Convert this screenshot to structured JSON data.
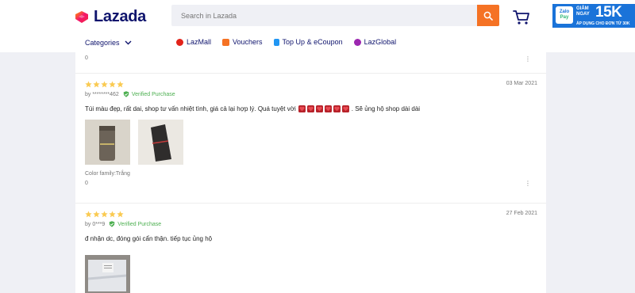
{
  "header": {
    "logo_text": "Lazada",
    "search_placeholder": "Search in Lazada",
    "icons": {
      "search": "search-icon",
      "cart": "cart-icon"
    },
    "promo": {
      "pay_top": "Zalo",
      "pay_bottom": "Pay",
      "label": "GIẢM NGAY",
      "amount": "15K",
      "sub": "ÁP DỤNG CHO ĐƠN TỪ 30K"
    }
  },
  "nav": {
    "categories_label": "Categories",
    "links": [
      {
        "label": "LazMall",
        "icon": "lazmall-icon",
        "color": "#e2231a"
      },
      {
        "label": "Vouchers",
        "icon": "voucher-icon",
        "color": "#f57224"
      },
      {
        "label": "Top Up & eCoupon",
        "icon": "topup-icon",
        "color": "#2196f3"
      },
      {
        "label": "LazGlobal",
        "icon": "lazglobal-icon",
        "color": "#9c27b0"
      }
    ]
  },
  "reviews": {
    "previous_likes": "0",
    "items": [
      {
        "rating": 5,
        "author": "by ********462",
        "verified": "Verified Purchase",
        "date": "03 Mar 2021",
        "text_before": "Túi màu đẹp, rất dai, shop tư vấn nhiệt tình, giá cả lại hợp lý. Quá tuyệt vời",
        "hearts": 6,
        "text_after": ". Sẽ ủng hộ shop dài dài",
        "photos": 2,
        "sku": "Color family:Trắng",
        "likes": "0"
      },
      {
        "rating": 5,
        "author": "by 0***9",
        "verified": "Verified Purchase",
        "date": "27 Feb 2021",
        "text": "đ nhận dc, đóng gói cẩn thận. tiếp tục ủng hộ",
        "photos": 1
      }
    ]
  },
  "colors": {
    "accent_orange": "#f57224",
    "brand_navy": "#0f146d",
    "star_orange": "#faca51",
    "verified_green": "#4caf50",
    "promo_blue": "#1a73d9"
  }
}
